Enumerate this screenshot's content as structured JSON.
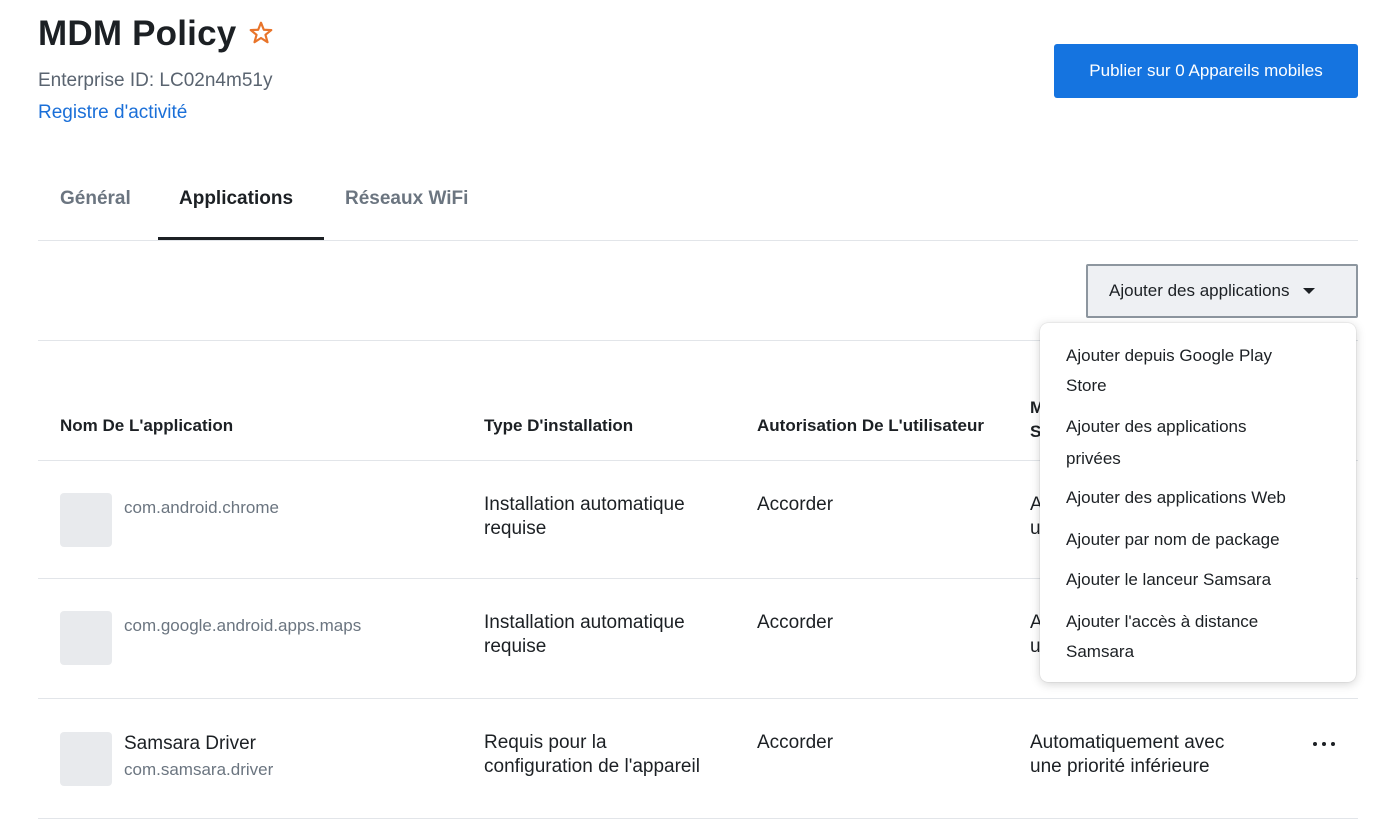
{
  "header": {
    "title": "MDM Policy",
    "enterprise_id": "Enterprise ID: LC02n4m51y",
    "activity_link": "Registre d'activité",
    "publish_button": "Publier sur 0 Appareils mobiles"
  },
  "tabs": [
    {
      "label": "Général",
      "active": false
    },
    {
      "label": "Applications",
      "active": true
    },
    {
      "label": "Réseaux WiFi",
      "active": false
    }
  ],
  "toolbar": {
    "add_apps_label": "Ajouter des applications"
  },
  "table": {
    "columns": [
      "Nom De L'application",
      "Type D'installation",
      "Autorisation De L'utilisateur",
      "M\nS"
    ],
    "rows": [
      {
        "name": "",
        "package": "com.android.chrome",
        "install_type": "Installation automatique\nrequise",
        "permission": "Accorder",
        "update": "A\nu"
      },
      {
        "name": "",
        "package": "com.google.android.apps.maps",
        "install_type": "Installation automatique\nrequise",
        "permission": "Accorder",
        "update": "A\nu"
      },
      {
        "name": "Samsara Driver",
        "package": "com.samsara.driver",
        "install_type": "Requis pour la\nconfiguration de l'appareil",
        "permission": "Accorder",
        "update": "Automatiquement avec\nune priorité inférieure"
      }
    ]
  },
  "add_menu": {
    "items": [
      "Ajouter depuis Google Play\nStore",
      "Ajouter des applications\nprivées",
      "Ajouter des applications Web",
      "Ajouter par nom de package",
      "Ajouter le lanceur Samsara",
      "Ajouter l'accès à distance\nSamsara"
    ]
  },
  "colors": {
    "primary": "#1574e0",
    "link": "#1a6fd8",
    "star": "#e8742a",
    "text": "#1c2024",
    "muted": "#6b7580"
  },
  "icons": [
    "star-icon",
    "caret-down-icon",
    "more-options-icon"
  ]
}
